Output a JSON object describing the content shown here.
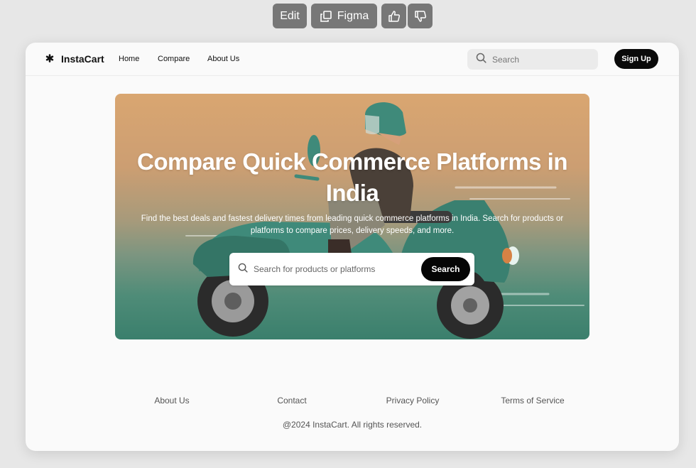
{
  "toolbar": {
    "edit_label": "Edit",
    "figma_label": "Figma",
    "icons": [
      "copy-icon",
      "thumbs-up-icon",
      "thumbs-down-icon"
    ]
  },
  "nav": {
    "brand": "InstaCart",
    "brand_icon": "asterisk-logo-icon",
    "links": [
      "Home",
      "Compare",
      "About Us"
    ],
    "search_placeholder": "Search",
    "signup_label": "Sign Up"
  },
  "hero": {
    "title": "Compare Quick Commerce Platforms in India",
    "subtitle": "Find the best deals and fastest delivery times from leading quick commerce platforms in India. Search for products or platforms to compare prices, delivery speeds, and more.",
    "search_placeholder": "Search for products or platforms",
    "search_button": "Search"
  },
  "footer": {
    "links": [
      "About Us",
      "Contact",
      "Privacy Policy",
      "Terms of Service"
    ],
    "copyright": "@2024 InstaCart. All rights reserved."
  },
  "colors": {
    "page_bg": "#e7e7e7",
    "card_bg": "#fafafa",
    "toolbar_button": "#777777",
    "primary_button": "#0a0a0a",
    "scooter_teal": "#3f8a7a"
  }
}
